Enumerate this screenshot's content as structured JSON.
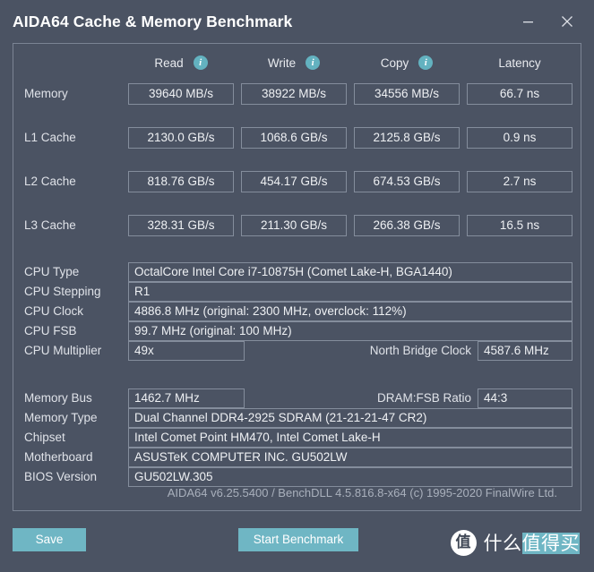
{
  "window": {
    "title": "AIDA64 Cache & Memory Benchmark",
    "minimize_label": "–",
    "close_label": "✕"
  },
  "benchmark": {
    "columns": [
      {
        "label": "Read",
        "icon": "info-icon",
        "has_info": true
      },
      {
        "label": "Write",
        "icon": "info-icon",
        "has_info": true
      },
      {
        "label": "Copy",
        "icon": "info-icon",
        "has_info": true
      },
      {
        "label": "Latency",
        "icon": "",
        "has_info": false
      }
    ],
    "info_glyph": "i",
    "rows": [
      {
        "label": "Memory",
        "read": "39640 MB/s",
        "write": "38922 MB/s",
        "copy": "34556 MB/s",
        "latency": "66.7 ns"
      },
      {
        "label": "L1 Cache",
        "read": "2130.0 GB/s",
        "write": "1068.6 GB/s",
        "copy": "2125.8 GB/s",
        "latency": "0.9 ns"
      },
      {
        "label": "L2 Cache",
        "read": "818.76 GB/s",
        "write": "454.17 GB/s",
        "copy": "674.53 GB/s",
        "latency": "2.7 ns"
      },
      {
        "label": "L3 Cache",
        "read": "328.31 GB/s",
        "write": "211.30 GB/s",
        "copy": "266.38 GB/s",
        "latency": "16.5 ns"
      }
    ]
  },
  "cpu_info": {
    "cpu_type": {
      "label": "CPU Type",
      "value": "OctalCore Intel Core i7-10875H  (Comet Lake-H, BGA1440)"
    },
    "cpu_stepping": {
      "label": "CPU Stepping",
      "value": "R1"
    },
    "cpu_clock": {
      "label": "CPU Clock",
      "value": "4886.8 MHz  (original: 2300 MHz, overclock: 112%)"
    },
    "cpu_fsb": {
      "label": "CPU FSB",
      "value": "99.7 MHz  (original: 100 MHz)"
    },
    "cpu_multiplier": {
      "label": "CPU Multiplier",
      "value": "49x"
    },
    "north_bridge": {
      "label": "North Bridge Clock",
      "value": "4587.6 MHz"
    }
  },
  "system_info": {
    "memory_bus": {
      "label": "Memory Bus",
      "value": "1462.7 MHz"
    },
    "dram_ratio": {
      "label": "DRAM:FSB Ratio",
      "value": "44:3"
    },
    "memory_type": {
      "label": "Memory Type",
      "value": "Dual Channel DDR4-2925 SDRAM  (21-21-21-47 CR2)"
    },
    "chipset": {
      "label": "Chipset",
      "value": "Intel Comet Point HM470, Intel Comet Lake-H"
    },
    "motherboard": {
      "label": "Motherboard",
      "value": "ASUSTeK COMPUTER INC. GU502LW"
    },
    "bios_version": {
      "label": "BIOS Version",
      "value": "GU502LW.305"
    }
  },
  "footer": {
    "version_text": "AIDA64 v6.25.5400 / BenchDLL 4.5.816.8-x64  (c) 1995-2020 FinalWire Ltd."
  },
  "actions": {
    "save_label": "Save",
    "start_label": "Start Benchmark"
  },
  "watermark": {
    "logo_char": "值",
    "text_plain": "什么",
    "text_highlight": "值得买"
  },
  "colors": {
    "window_bg": "#4b5363",
    "accent": "#6fb6c4",
    "info_icon": "#63b2c0",
    "border": "#848d9c",
    "text": "#e8eaee",
    "muted_text": "#a9b0bc"
  }
}
